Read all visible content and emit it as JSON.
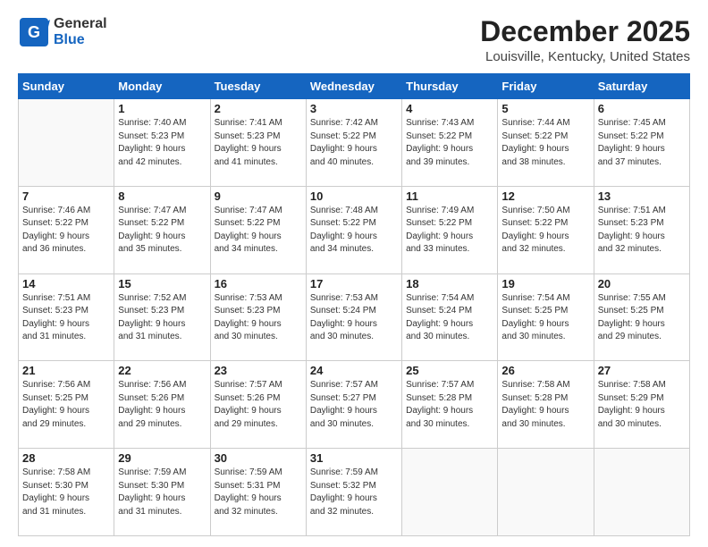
{
  "logo": {
    "text_general": "General",
    "text_blue": "Blue"
  },
  "title": "December 2025",
  "location": "Louisville, Kentucky, United States",
  "days_of_week": [
    "Sunday",
    "Monday",
    "Tuesday",
    "Wednesday",
    "Thursday",
    "Friday",
    "Saturday"
  ],
  "weeks": [
    [
      {
        "day": "",
        "info": ""
      },
      {
        "day": "1",
        "info": "Sunrise: 7:40 AM\nSunset: 5:23 PM\nDaylight: 9 hours\nand 42 minutes."
      },
      {
        "day": "2",
        "info": "Sunrise: 7:41 AM\nSunset: 5:23 PM\nDaylight: 9 hours\nand 41 minutes."
      },
      {
        "day": "3",
        "info": "Sunrise: 7:42 AM\nSunset: 5:22 PM\nDaylight: 9 hours\nand 40 minutes."
      },
      {
        "day": "4",
        "info": "Sunrise: 7:43 AM\nSunset: 5:22 PM\nDaylight: 9 hours\nand 39 minutes."
      },
      {
        "day": "5",
        "info": "Sunrise: 7:44 AM\nSunset: 5:22 PM\nDaylight: 9 hours\nand 38 minutes."
      },
      {
        "day": "6",
        "info": "Sunrise: 7:45 AM\nSunset: 5:22 PM\nDaylight: 9 hours\nand 37 minutes."
      }
    ],
    [
      {
        "day": "7",
        "info": "Sunrise: 7:46 AM\nSunset: 5:22 PM\nDaylight: 9 hours\nand 36 minutes."
      },
      {
        "day": "8",
        "info": "Sunrise: 7:47 AM\nSunset: 5:22 PM\nDaylight: 9 hours\nand 35 minutes."
      },
      {
        "day": "9",
        "info": "Sunrise: 7:47 AM\nSunset: 5:22 PM\nDaylight: 9 hours\nand 34 minutes."
      },
      {
        "day": "10",
        "info": "Sunrise: 7:48 AM\nSunset: 5:22 PM\nDaylight: 9 hours\nand 34 minutes."
      },
      {
        "day": "11",
        "info": "Sunrise: 7:49 AM\nSunset: 5:22 PM\nDaylight: 9 hours\nand 33 minutes."
      },
      {
        "day": "12",
        "info": "Sunrise: 7:50 AM\nSunset: 5:22 PM\nDaylight: 9 hours\nand 32 minutes."
      },
      {
        "day": "13",
        "info": "Sunrise: 7:51 AM\nSunset: 5:23 PM\nDaylight: 9 hours\nand 32 minutes."
      }
    ],
    [
      {
        "day": "14",
        "info": "Sunrise: 7:51 AM\nSunset: 5:23 PM\nDaylight: 9 hours\nand 31 minutes."
      },
      {
        "day": "15",
        "info": "Sunrise: 7:52 AM\nSunset: 5:23 PM\nDaylight: 9 hours\nand 31 minutes."
      },
      {
        "day": "16",
        "info": "Sunrise: 7:53 AM\nSunset: 5:23 PM\nDaylight: 9 hours\nand 30 minutes."
      },
      {
        "day": "17",
        "info": "Sunrise: 7:53 AM\nSunset: 5:24 PM\nDaylight: 9 hours\nand 30 minutes."
      },
      {
        "day": "18",
        "info": "Sunrise: 7:54 AM\nSunset: 5:24 PM\nDaylight: 9 hours\nand 30 minutes."
      },
      {
        "day": "19",
        "info": "Sunrise: 7:54 AM\nSunset: 5:25 PM\nDaylight: 9 hours\nand 30 minutes."
      },
      {
        "day": "20",
        "info": "Sunrise: 7:55 AM\nSunset: 5:25 PM\nDaylight: 9 hours\nand 29 minutes."
      }
    ],
    [
      {
        "day": "21",
        "info": "Sunrise: 7:56 AM\nSunset: 5:25 PM\nDaylight: 9 hours\nand 29 minutes."
      },
      {
        "day": "22",
        "info": "Sunrise: 7:56 AM\nSunset: 5:26 PM\nDaylight: 9 hours\nand 29 minutes."
      },
      {
        "day": "23",
        "info": "Sunrise: 7:57 AM\nSunset: 5:26 PM\nDaylight: 9 hours\nand 29 minutes."
      },
      {
        "day": "24",
        "info": "Sunrise: 7:57 AM\nSunset: 5:27 PM\nDaylight: 9 hours\nand 30 minutes."
      },
      {
        "day": "25",
        "info": "Sunrise: 7:57 AM\nSunset: 5:28 PM\nDaylight: 9 hours\nand 30 minutes."
      },
      {
        "day": "26",
        "info": "Sunrise: 7:58 AM\nSunset: 5:28 PM\nDaylight: 9 hours\nand 30 minutes."
      },
      {
        "day": "27",
        "info": "Sunrise: 7:58 AM\nSunset: 5:29 PM\nDaylight: 9 hours\nand 30 minutes."
      }
    ],
    [
      {
        "day": "28",
        "info": "Sunrise: 7:58 AM\nSunset: 5:30 PM\nDaylight: 9 hours\nand 31 minutes."
      },
      {
        "day": "29",
        "info": "Sunrise: 7:59 AM\nSunset: 5:30 PM\nDaylight: 9 hours\nand 31 minutes."
      },
      {
        "day": "30",
        "info": "Sunrise: 7:59 AM\nSunset: 5:31 PM\nDaylight: 9 hours\nand 32 minutes."
      },
      {
        "day": "31",
        "info": "Sunrise: 7:59 AM\nSunset: 5:32 PM\nDaylight: 9 hours\nand 32 minutes."
      },
      {
        "day": "",
        "info": ""
      },
      {
        "day": "",
        "info": ""
      },
      {
        "day": "",
        "info": ""
      }
    ]
  ]
}
